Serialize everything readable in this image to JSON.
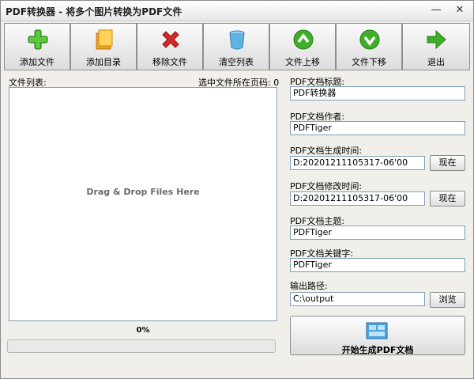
{
  "window": {
    "title": "PDF转换器 - 将多个图片转换为PDF文件",
    "min_glyph": "—",
    "close_glyph": "✕"
  },
  "toolbar": {
    "buttons": [
      {
        "label": "添加文件",
        "icon": "plus-icon"
      },
      {
        "label": "添加目录",
        "icon": "folder-icon"
      },
      {
        "label": "移除文件",
        "icon": "delete-x-icon"
      },
      {
        "label": "清空列表",
        "icon": "bin-icon"
      },
      {
        "label": "文件上移",
        "icon": "arrow-up-icon"
      },
      {
        "label": "文件下移",
        "icon": "arrow-down-icon"
      },
      {
        "label": "退出",
        "icon": "exit-arrow-icon"
      }
    ]
  },
  "filelist": {
    "label": "文件列表:",
    "page_label": "选中文件所在页码: 0",
    "drop_hint": "Drag & Drop Files Here"
  },
  "progress": {
    "percent_text": "0%",
    "value": 0
  },
  "form": {
    "title_label": "PDF文档标题:",
    "title_value": "PDF转换器",
    "author_label": "PDF文档作者:",
    "author_value": "PDFTiger",
    "created_label": "PDF文档生成时间:",
    "created_value": "D:20201211105317-06'00",
    "modified_label": "PDF文档修改时间:",
    "modified_value": "D:20201211105317-06'00",
    "subject_label": "PDF文档主题:",
    "subject_value": "PDFTiger",
    "keywords_label": "PDF文档关键字:",
    "keywords_value": "PDFTiger",
    "output_label": "输出路径:",
    "output_value": "C:\\output",
    "now_label": "现在",
    "browse_label": "浏览",
    "generate_label": "开始生成PDF文档"
  },
  "colors": {
    "field_border": "#7f9db9",
    "icon_green": "#3fae2a",
    "icon_red": "#d62828"
  }
}
